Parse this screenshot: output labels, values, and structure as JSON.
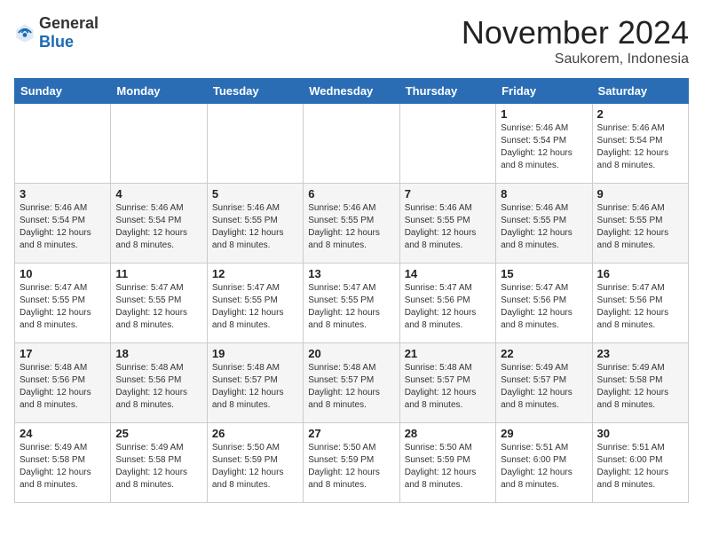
{
  "logo": {
    "text_general": "General",
    "text_blue": "Blue"
  },
  "title": "November 2024",
  "location": "Saukorem, Indonesia",
  "days_of_week": [
    "Sunday",
    "Monday",
    "Tuesday",
    "Wednesday",
    "Thursday",
    "Friday",
    "Saturday"
  ],
  "weeks": [
    [
      {
        "day": "",
        "info": ""
      },
      {
        "day": "",
        "info": ""
      },
      {
        "day": "",
        "info": ""
      },
      {
        "day": "",
        "info": ""
      },
      {
        "day": "",
        "info": ""
      },
      {
        "day": "1",
        "info": "Sunrise: 5:46 AM\nSunset: 5:54 PM\nDaylight: 12 hours\nand 8 minutes."
      },
      {
        "day": "2",
        "info": "Sunrise: 5:46 AM\nSunset: 5:54 PM\nDaylight: 12 hours\nand 8 minutes."
      }
    ],
    [
      {
        "day": "3",
        "info": "Sunrise: 5:46 AM\nSunset: 5:54 PM\nDaylight: 12 hours\nand 8 minutes."
      },
      {
        "day": "4",
        "info": "Sunrise: 5:46 AM\nSunset: 5:54 PM\nDaylight: 12 hours\nand 8 minutes."
      },
      {
        "day": "5",
        "info": "Sunrise: 5:46 AM\nSunset: 5:55 PM\nDaylight: 12 hours\nand 8 minutes."
      },
      {
        "day": "6",
        "info": "Sunrise: 5:46 AM\nSunset: 5:55 PM\nDaylight: 12 hours\nand 8 minutes."
      },
      {
        "day": "7",
        "info": "Sunrise: 5:46 AM\nSunset: 5:55 PM\nDaylight: 12 hours\nand 8 minutes."
      },
      {
        "day": "8",
        "info": "Sunrise: 5:46 AM\nSunset: 5:55 PM\nDaylight: 12 hours\nand 8 minutes."
      },
      {
        "day": "9",
        "info": "Sunrise: 5:46 AM\nSunset: 5:55 PM\nDaylight: 12 hours\nand 8 minutes."
      }
    ],
    [
      {
        "day": "10",
        "info": "Sunrise: 5:47 AM\nSunset: 5:55 PM\nDaylight: 12 hours\nand 8 minutes."
      },
      {
        "day": "11",
        "info": "Sunrise: 5:47 AM\nSunset: 5:55 PM\nDaylight: 12 hours\nand 8 minutes."
      },
      {
        "day": "12",
        "info": "Sunrise: 5:47 AM\nSunset: 5:55 PM\nDaylight: 12 hours\nand 8 minutes."
      },
      {
        "day": "13",
        "info": "Sunrise: 5:47 AM\nSunset: 5:55 PM\nDaylight: 12 hours\nand 8 minutes."
      },
      {
        "day": "14",
        "info": "Sunrise: 5:47 AM\nSunset: 5:56 PM\nDaylight: 12 hours\nand 8 minutes."
      },
      {
        "day": "15",
        "info": "Sunrise: 5:47 AM\nSunset: 5:56 PM\nDaylight: 12 hours\nand 8 minutes."
      },
      {
        "day": "16",
        "info": "Sunrise: 5:47 AM\nSunset: 5:56 PM\nDaylight: 12 hours\nand 8 minutes."
      }
    ],
    [
      {
        "day": "17",
        "info": "Sunrise: 5:48 AM\nSunset: 5:56 PM\nDaylight: 12 hours\nand 8 minutes."
      },
      {
        "day": "18",
        "info": "Sunrise: 5:48 AM\nSunset: 5:56 PM\nDaylight: 12 hours\nand 8 minutes."
      },
      {
        "day": "19",
        "info": "Sunrise: 5:48 AM\nSunset: 5:57 PM\nDaylight: 12 hours\nand 8 minutes."
      },
      {
        "day": "20",
        "info": "Sunrise: 5:48 AM\nSunset: 5:57 PM\nDaylight: 12 hours\nand 8 minutes."
      },
      {
        "day": "21",
        "info": "Sunrise: 5:48 AM\nSunset: 5:57 PM\nDaylight: 12 hours\nand 8 minutes."
      },
      {
        "day": "22",
        "info": "Sunrise: 5:49 AM\nSunset: 5:57 PM\nDaylight: 12 hours\nand 8 minutes."
      },
      {
        "day": "23",
        "info": "Sunrise: 5:49 AM\nSunset: 5:58 PM\nDaylight: 12 hours\nand 8 minutes."
      }
    ],
    [
      {
        "day": "24",
        "info": "Sunrise: 5:49 AM\nSunset: 5:58 PM\nDaylight: 12 hours\nand 8 minutes."
      },
      {
        "day": "25",
        "info": "Sunrise: 5:49 AM\nSunset: 5:58 PM\nDaylight: 12 hours\nand 8 minutes."
      },
      {
        "day": "26",
        "info": "Sunrise: 5:50 AM\nSunset: 5:59 PM\nDaylight: 12 hours\nand 8 minutes."
      },
      {
        "day": "27",
        "info": "Sunrise: 5:50 AM\nSunset: 5:59 PM\nDaylight: 12 hours\nand 8 minutes."
      },
      {
        "day": "28",
        "info": "Sunrise: 5:50 AM\nSunset: 5:59 PM\nDaylight: 12 hours\nand 8 minutes."
      },
      {
        "day": "29",
        "info": "Sunrise: 5:51 AM\nSunset: 6:00 PM\nDaylight: 12 hours\nand 8 minutes."
      },
      {
        "day": "30",
        "info": "Sunrise: 5:51 AM\nSunset: 6:00 PM\nDaylight: 12 hours\nand 8 minutes."
      }
    ]
  ]
}
